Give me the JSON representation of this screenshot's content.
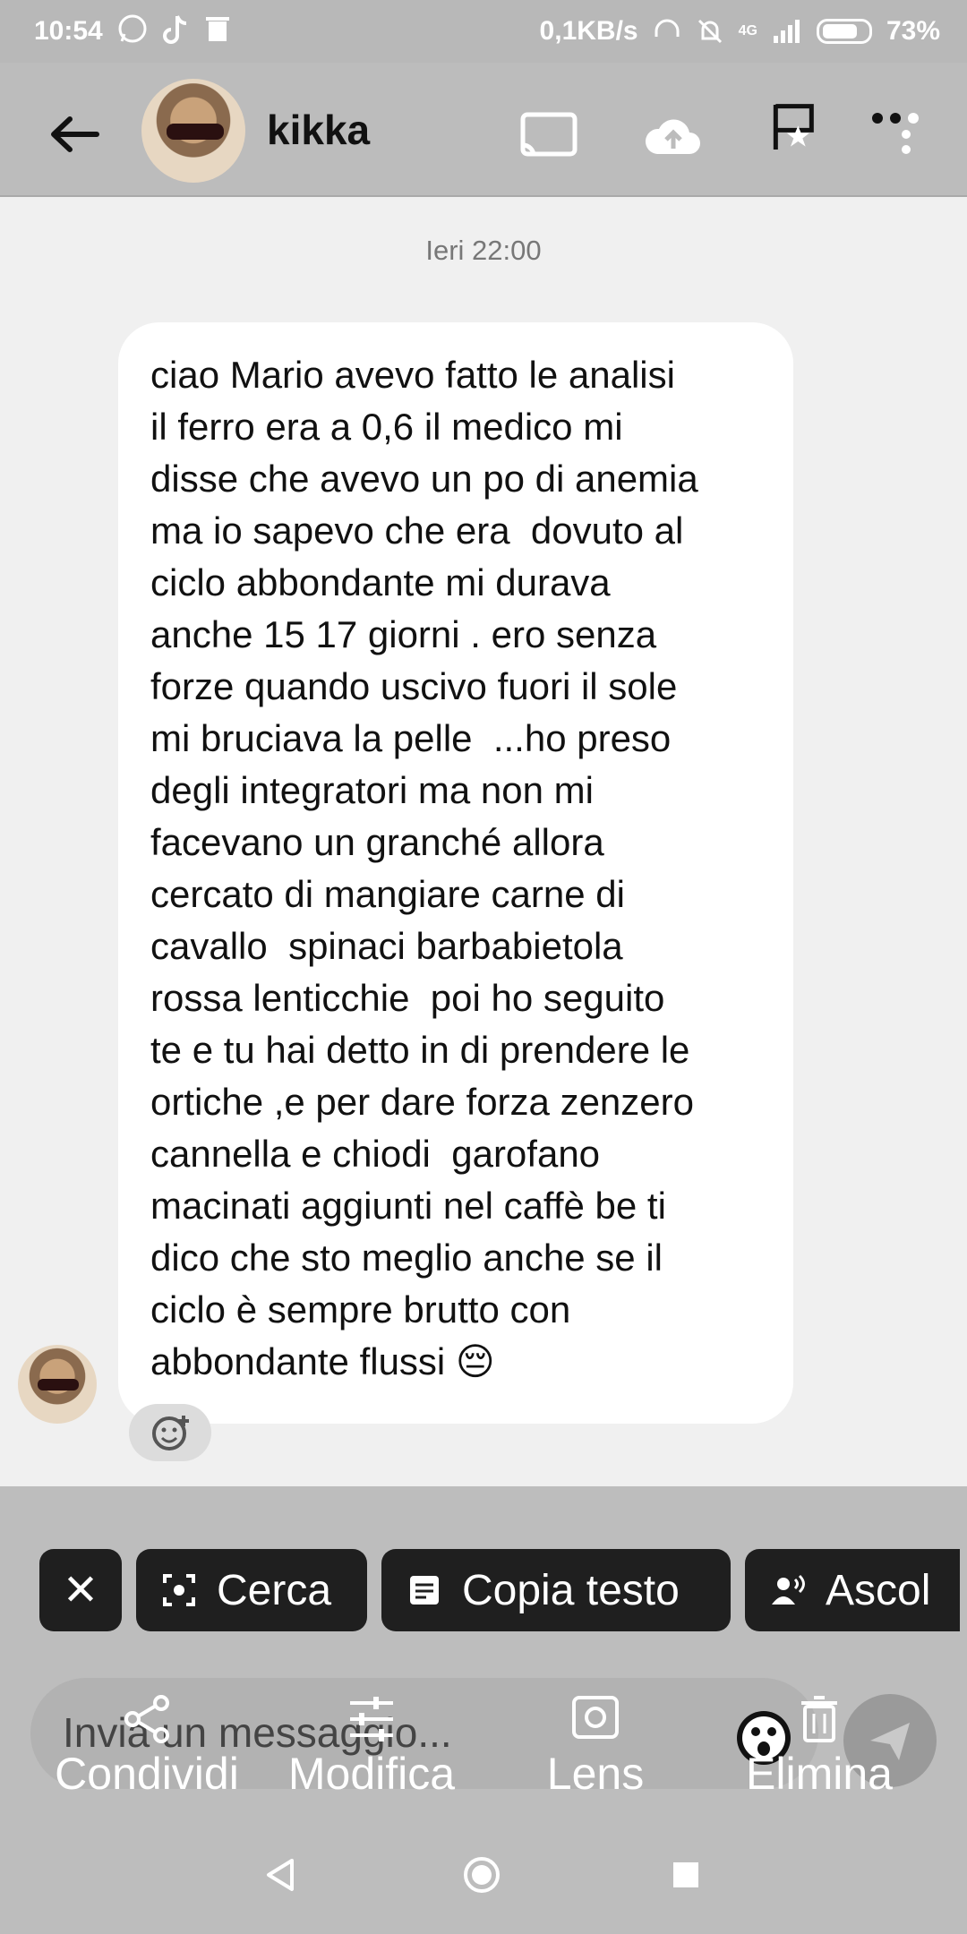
{
  "status_bar": {
    "time": "10:54",
    "network_speed": "0,1KB/s",
    "network_type": "4G",
    "battery": "73%"
  },
  "header": {
    "contact_name": "kikka"
  },
  "chat": {
    "datestamp": "Ieri 22:00",
    "message": "ciao Mario avevo fatto le analisi\nil ferro era a 0,6 il medico mi\ndisse che avevo un po di anemia\nma io sapevo che era  dovuto al\nciclo abbondante mi durava\nanche 15 17 giorni . ero senza\nforze quando uscivo fuori il sole\nmi bruciava la pelle  ...ho preso\ndegli integratori ma non mi\nfacevano un granché allora\ncercato di mangiare carne di\ncavallo  spinaci barbabietola\nrossa lenticchie  poi ho seguito\nte e tu hai detto in di prendere le\nortiche ,e per dare forza zenzero\ncannella e chiodi  garofano\nmacinati aggiunti nel caffè be ti\ndico che sto meglio anche se il\nciclo è sempre brutto con\nabbondante flussi 😔"
  },
  "chips": {
    "close": "✕",
    "search": "Cerca",
    "copy": "Copia testo",
    "listen": "Ascol"
  },
  "composer": {
    "placeholder": "Invia un messaggio..."
  },
  "actions": {
    "share": "Condividi",
    "edit": "Modifica",
    "lens": "Lens",
    "delete": "Elimina"
  },
  "colors": {
    "overlay": "#bdbdbd",
    "chip_bg": "#1f1f1f",
    "bubble_bg": "#ffffff"
  }
}
